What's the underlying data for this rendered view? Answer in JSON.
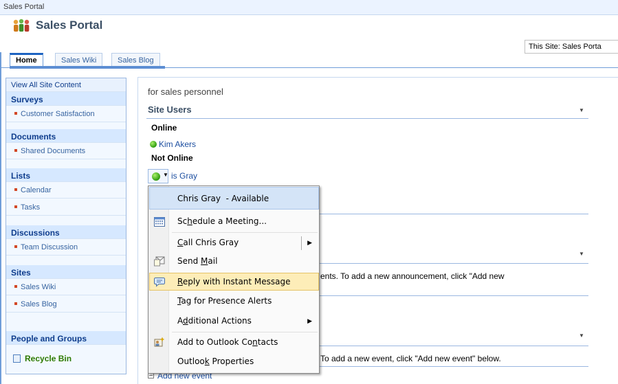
{
  "topbar": {
    "title": "Sales Portal"
  },
  "header": {
    "site_title": "Sales Portal",
    "search_scope": "This Site: Sales Porta"
  },
  "tabs": [
    {
      "label": "Home",
      "active": true
    },
    {
      "label": "Sales Wiki",
      "active": false
    },
    {
      "label": "Sales Blog",
      "active": false
    }
  ],
  "quicklaunch": {
    "view_all": "View All Site Content",
    "surveys": {
      "heading": "Surveys",
      "items": [
        "Customer Satisfaction"
      ]
    },
    "documents": {
      "heading": "Documents",
      "items": [
        "Shared Documents"
      ]
    },
    "lists": {
      "heading": "Lists",
      "items": [
        "Calendar",
        "Tasks"
      ]
    },
    "discussions": {
      "heading": "Discussions",
      "items": [
        "Team Discussion"
      ]
    },
    "sites": {
      "heading": "Sites",
      "items": [
        "Sales Wiki",
        "Sales Blog"
      ]
    },
    "people": {
      "heading": "People and Groups"
    },
    "recycle": "Recycle Bin"
  },
  "main": {
    "tagline": "for sales personnel",
    "site_users": {
      "title": "Site Users",
      "online_heading": "Online",
      "online_users": [
        "Kim Akers"
      ],
      "offline_heading": "Not Online",
      "partial_user": "is Gray"
    },
    "announcements_text": "ents. To add a new announcement, click \"Add new",
    "events_text": "To add a new event, click \"Add new event\" below.",
    "add_event": "Add new event"
  },
  "menu": {
    "header": {
      "name": "Chris Gray",
      "status": "- Available"
    },
    "items": {
      "schedule": {
        "pre": "Sc",
        "u": "h",
        "post": "edule a Meeting..."
      },
      "call": {
        "pre": "",
        "u": "C",
        "post": "all Chris Gray"
      },
      "mail": {
        "pre": "Send ",
        "u": "M",
        "post": "ail"
      },
      "reply": {
        "pre": "",
        "u": "R",
        "post": "eply with Instant Message"
      },
      "tag": {
        "pre": "",
        "u": "T",
        "post": "ag for Presence Alerts"
      },
      "additional": {
        "pre": "A",
        "u": "d",
        "post": "ditional Actions"
      },
      "add_contacts": {
        "pre": "Add to Outlook Co",
        "u": "n",
        "post": "tacts"
      },
      "properties": {
        "pre": "Outloo",
        "u": "k",
        "post": " Properties"
      }
    }
  },
  "colors": {
    "accent_blue": "#1d63c1",
    "quicklaunch_heading": "#0f3d8c",
    "link": "#1d4fa0",
    "menu_hover": "#fdedb8",
    "menu_header": "#d4e4f7",
    "presence_online": "#2c9b0d"
  }
}
